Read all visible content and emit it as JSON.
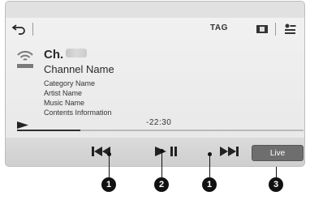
{
  "header": {
    "tag_label": "TAG"
  },
  "station": {
    "channel_prefix": "Ch.",
    "channel_name": "Channel Name",
    "category": "Category Name",
    "artist": "Artist Name",
    "music": "Music Name",
    "contents": "Contents Information"
  },
  "playback": {
    "time": "-22:30",
    "progress": 0.22
  },
  "controls": {
    "live_label": "Live"
  },
  "callouts": {
    "prev": "1",
    "play_pause": "2",
    "next": "1",
    "live": "3"
  },
  "icons": [
    "back-icon",
    "radio-icon",
    "tag-icon",
    "list-icon",
    "play-indicator-icon",
    "skip-back-icon",
    "play-pause-icon",
    "skip-forward-icon"
  ]
}
